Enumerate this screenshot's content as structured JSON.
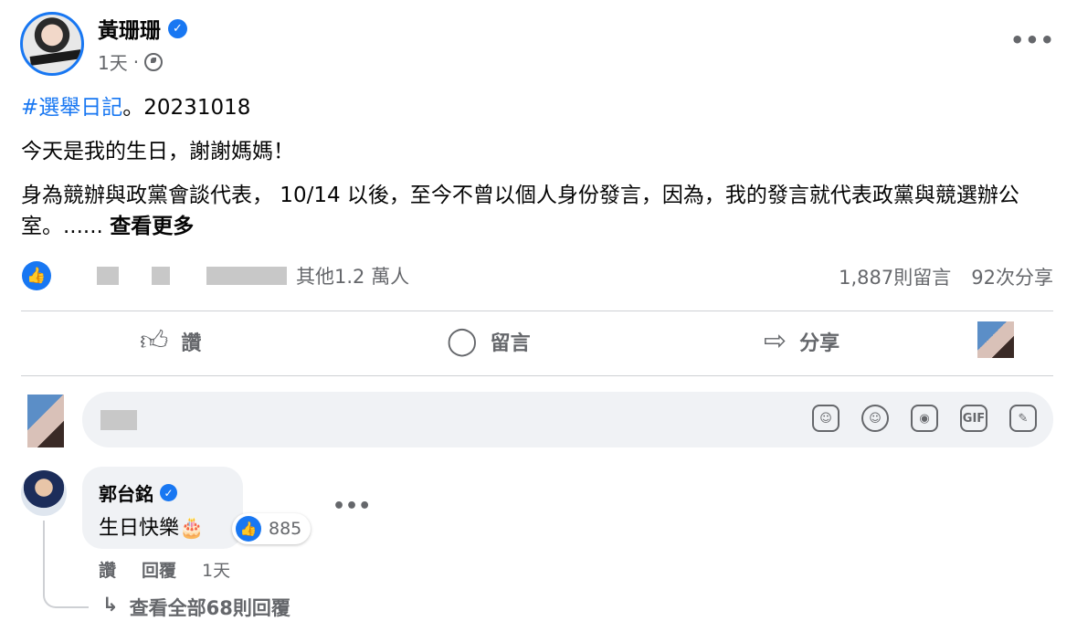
{
  "post": {
    "author": "黃珊珊",
    "time": "1天",
    "separator": "·",
    "hashtag": "#選舉日記",
    "date_suffix": "。20231018",
    "line2": "今天是我的生日，謝謝媽媽！",
    "line3": "身為競辦與政黨會談代表， 10/14 以後，至今不曾以個人身份發言，因為，我的發言就代表政黨與競選辦公室。......",
    "see_more": "查看更多",
    "reactions_text": "其他1.2 萬人",
    "comments_count": "1,887則留言",
    "shares_count": "92次分享"
  },
  "actions": {
    "like": "讚",
    "comment": "留言",
    "share": "分享"
  },
  "comment": {
    "author": "郭台銘",
    "text": "生日快樂🎂",
    "like_count": "885",
    "like_label": "讚",
    "reply_label": "回覆",
    "time": "1天",
    "view_replies": "查看全部68則回覆"
  },
  "icons": {
    "verified": "verified-badge-icon",
    "globe": "globe-icon",
    "like": "thumbs-up-icon",
    "comment": "speech-bubble-icon",
    "share": "share-arrow-icon",
    "sticker": "sticker-icon",
    "emoji": "emoji-icon",
    "camera": "camera-icon",
    "gif": "gif-icon",
    "avatar_sticker": "avatar-sticker-icon"
  },
  "colors": {
    "accent": "#1877f2",
    "muted": "#65676b",
    "bubble": "#f0f2f5"
  }
}
